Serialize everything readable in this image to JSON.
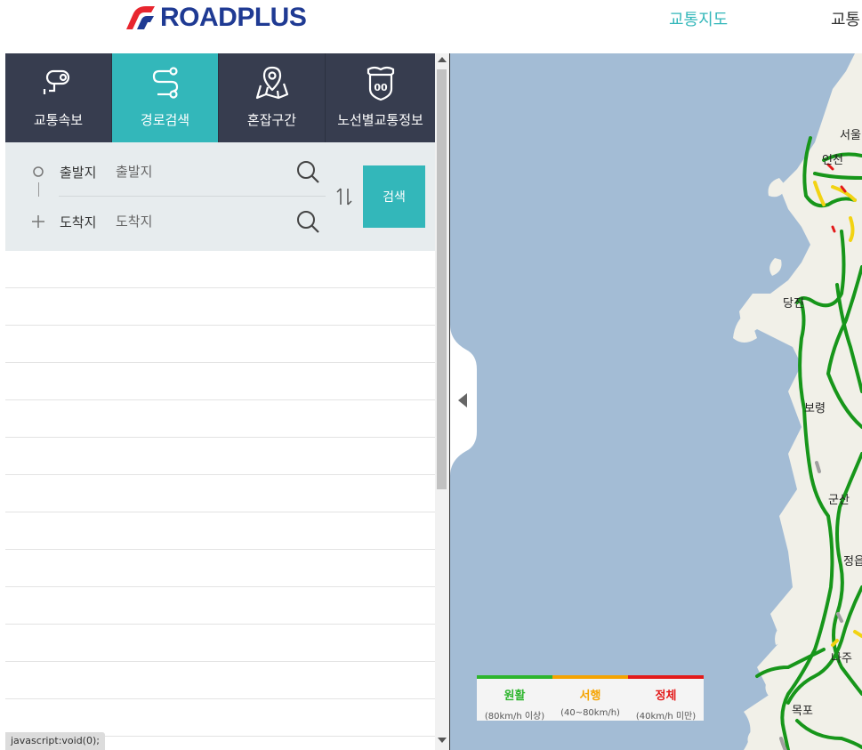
{
  "brand": {
    "logo_text": "ROADPLUS",
    "accent": "#33b7ba",
    "logo_color": "#1f3a93"
  },
  "nav": {
    "active_label": "교통지도",
    "second_label": "교통"
  },
  "tabs": [
    {
      "label": "교통속보",
      "icon": "cctv-icon"
    },
    {
      "label": "경로검색",
      "icon": "route-icon",
      "active": true
    },
    {
      "label": "혼잡구간",
      "icon": "map-pin-icon"
    },
    {
      "label": "노선별교통정보",
      "icon": "highway-shield-icon",
      "shield_text": "00"
    }
  ],
  "route_search": {
    "origin_label": "출발지",
    "origin_placeholder": "출발지",
    "destination_label": "도착지",
    "destination_placeholder": "도착지",
    "search_button": "검색"
  },
  "map": {
    "labels": [
      "서울",
      "인천",
      "당진",
      "보령",
      "군산",
      "정읍",
      "나주",
      "목포"
    ]
  },
  "legend": [
    {
      "name": "원활",
      "sub": "(80km/h 이상)",
      "color": "#2db52d"
    },
    {
      "name": "서행",
      "sub": "(40~80km/h)",
      "color": "#f5a300"
    },
    {
      "name": "정체",
      "sub": "(40km/h 미만)",
      "color": "#e31a1a"
    }
  ],
  "status_bar": {
    "text": "javascript:void(0);"
  }
}
